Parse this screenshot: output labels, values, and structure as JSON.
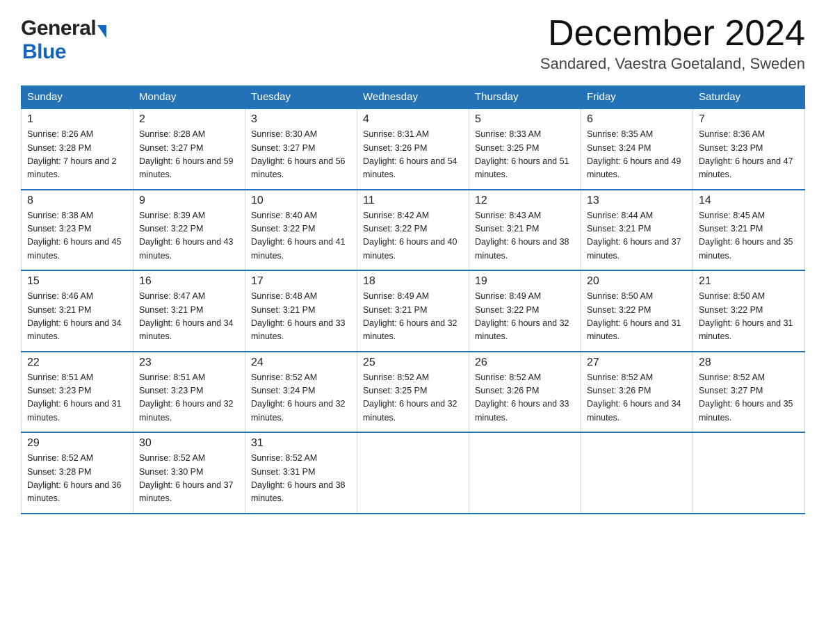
{
  "header": {
    "month_title": "December 2024",
    "location": "Sandared, Vaestra Goetaland, Sweden",
    "logo_general": "General",
    "logo_blue": "Blue"
  },
  "days_of_week": [
    "Sunday",
    "Monday",
    "Tuesday",
    "Wednesday",
    "Thursday",
    "Friday",
    "Saturday"
  ],
  "weeks": [
    [
      {
        "day": "1",
        "sunrise": "8:26 AM",
        "sunset": "3:28 PM",
        "daylight": "7 hours and 2 minutes."
      },
      {
        "day": "2",
        "sunrise": "8:28 AM",
        "sunset": "3:27 PM",
        "daylight": "6 hours and 59 minutes."
      },
      {
        "day": "3",
        "sunrise": "8:30 AM",
        "sunset": "3:27 PM",
        "daylight": "6 hours and 56 minutes."
      },
      {
        "day": "4",
        "sunrise": "8:31 AM",
        "sunset": "3:26 PM",
        "daylight": "6 hours and 54 minutes."
      },
      {
        "day": "5",
        "sunrise": "8:33 AM",
        "sunset": "3:25 PM",
        "daylight": "6 hours and 51 minutes."
      },
      {
        "day": "6",
        "sunrise": "8:35 AM",
        "sunset": "3:24 PM",
        "daylight": "6 hours and 49 minutes."
      },
      {
        "day": "7",
        "sunrise": "8:36 AM",
        "sunset": "3:23 PM",
        "daylight": "6 hours and 47 minutes."
      }
    ],
    [
      {
        "day": "8",
        "sunrise": "8:38 AM",
        "sunset": "3:23 PM",
        "daylight": "6 hours and 45 minutes."
      },
      {
        "day": "9",
        "sunrise": "8:39 AM",
        "sunset": "3:22 PM",
        "daylight": "6 hours and 43 minutes."
      },
      {
        "day": "10",
        "sunrise": "8:40 AM",
        "sunset": "3:22 PM",
        "daylight": "6 hours and 41 minutes."
      },
      {
        "day": "11",
        "sunrise": "8:42 AM",
        "sunset": "3:22 PM",
        "daylight": "6 hours and 40 minutes."
      },
      {
        "day": "12",
        "sunrise": "8:43 AM",
        "sunset": "3:21 PM",
        "daylight": "6 hours and 38 minutes."
      },
      {
        "day": "13",
        "sunrise": "8:44 AM",
        "sunset": "3:21 PM",
        "daylight": "6 hours and 37 minutes."
      },
      {
        "day": "14",
        "sunrise": "8:45 AM",
        "sunset": "3:21 PM",
        "daylight": "6 hours and 35 minutes."
      }
    ],
    [
      {
        "day": "15",
        "sunrise": "8:46 AM",
        "sunset": "3:21 PM",
        "daylight": "6 hours and 34 minutes."
      },
      {
        "day": "16",
        "sunrise": "8:47 AM",
        "sunset": "3:21 PM",
        "daylight": "6 hours and 34 minutes."
      },
      {
        "day": "17",
        "sunrise": "8:48 AM",
        "sunset": "3:21 PM",
        "daylight": "6 hours and 33 minutes."
      },
      {
        "day": "18",
        "sunrise": "8:49 AM",
        "sunset": "3:21 PM",
        "daylight": "6 hours and 32 minutes."
      },
      {
        "day": "19",
        "sunrise": "8:49 AM",
        "sunset": "3:22 PM",
        "daylight": "6 hours and 32 minutes."
      },
      {
        "day": "20",
        "sunrise": "8:50 AM",
        "sunset": "3:22 PM",
        "daylight": "6 hours and 31 minutes."
      },
      {
        "day": "21",
        "sunrise": "8:50 AM",
        "sunset": "3:22 PM",
        "daylight": "6 hours and 31 minutes."
      }
    ],
    [
      {
        "day": "22",
        "sunrise": "8:51 AM",
        "sunset": "3:23 PM",
        "daylight": "6 hours and 31 minutes."
      },
      {
        "day": "23",
        "sunrise": "8:51 AM",
        "sunset": "3:23 PM",
        "daylight": "6 hours and 32 minutes."
      },
      {
        "day": "24",
        "sunrise": "8:52 AM",
        "sunset": "3:24 PM",
        "daylight": "6 hours and 32 minutes."
      },
      {
        "day": "25",
        "sunrise": "8:52 AM",
        "sunset": "3:25 PM",
        "daylight": "6 hours and 32 minutes."
      },
      {
        "day": "26",
        "sunrise": "8:52 AM",
        "sunset": "3:26 PM",
        "daylight": "6 hours and 33 minutes."
      },
      {
        "day": "27",
        "sunrise": "8:52 AM",
        "sunset": "3:26 PM",
        "daylight": "6 hours and 34 minutes."
      },
      {
        "day": "28",
        "sunrise": "8:52 AM",
        "sunset": "3:27 PM",
        "daylight": "6 hours and 35 minutes."
      }
    ],
    [
      {
        "day": "29",
        "sunrise": "8:52 AM",
        "sunset": "3:28 PM",
        "daylight": "6 hours and 36 minutes."
      },
      {
        "day": "30",
        "sunrise": "8:52 AM",
        "sunset": "3:30 PM",
        "daylight": "6 hours and 37 minutes."
      },
      {
        "day": "31",
        "sunrise": "8:52 AM",
        "sunset": "3:31 PM",
        "daylight": "6 hours and 38 minutes."
      },
      {
        "day": "",
        "sunrise": "",
        "sunset": "",
        "daylight": ""
      },
      {
        "day": "",
        "sunrise": "",
        "sunset": "",
        "daylight": ""
      },
      {
        "day": "",
        "sunrise": "",
        "sunset": "",
        "daylight": ""
      },
      {
        "day": "",
        "sunrise": "",
        "sunset": "",
        "daylight": ""
      }
    ]
  ],
  "labels": {
    "sunrise": "Sunrise:",
    "sunset": "Sunset:",
    "daylight": "Daylight:"
  }
}
